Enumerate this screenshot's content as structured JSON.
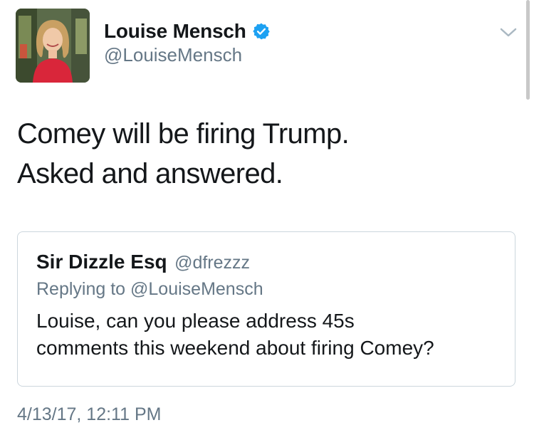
{
  "author": {
    "display_name": "Louise Mensch",
    "handle": "@LouiseMensch",
    "verified": true,
    "icons": {
      "avatar": "profile-photo",
      "verified": "verified-badge-icon",
      "menu": "chevron-down-icon"
    }
  },
  "tweet": {
    "lines": [
      "Comey will be firing Trump.",
      "Asked and answered."
    ],
    "timestamp": "4/13/17, 12:11 PM"
  },
  "quoted_tweet": {
    "display_name": "Sir Dizzle Esq",
    "handle": "@dfrezzz",
    "replying_to": "Replying to @LouiseMensch",
    "lines": [
      "Louise, can you please address 45s",
      "comments this weekend about firing Comey?"
    ]
  },
  "colors": {
    "primary_text": "#14171a",
    "secondary_text": "#657786",
    "verified_blue": "#1da1f2",
    "border": "#ccd6dd"
  }
}
